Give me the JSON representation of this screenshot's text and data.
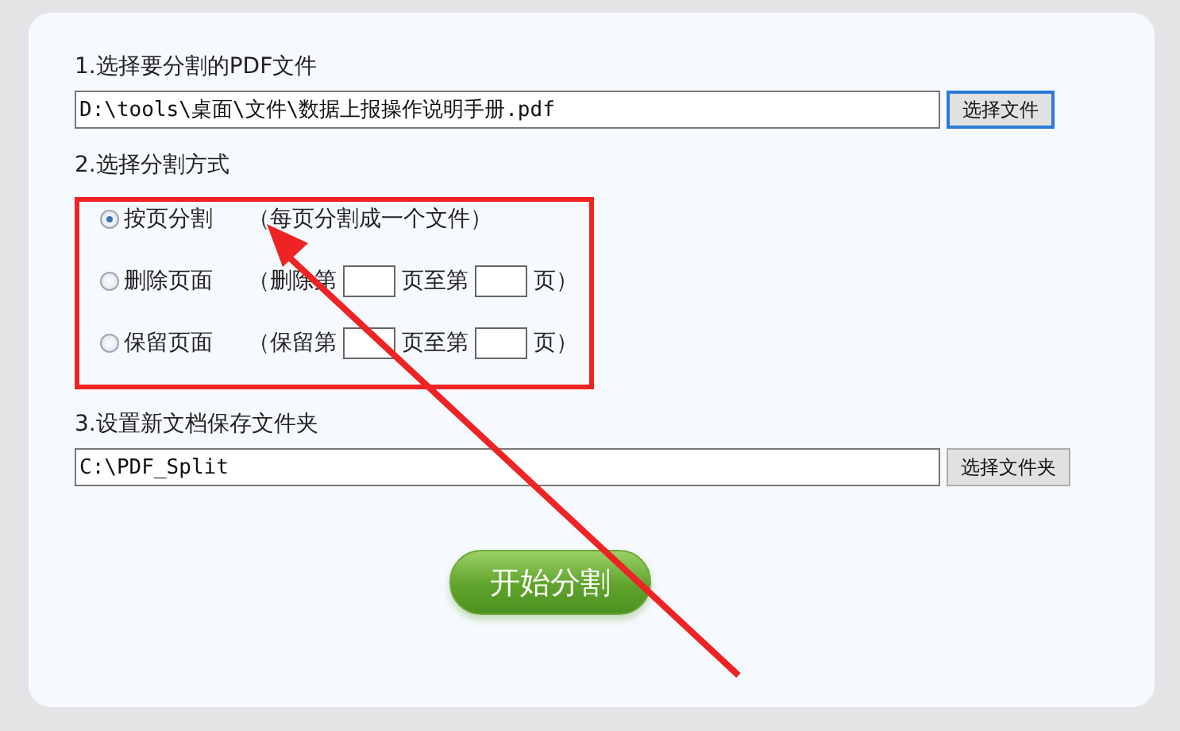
{
  "file_section": {
    "label": "1.选择要分割的PDF文件",
    "value": "D:\\tools\\桌面\\文件\\数据上报操作说明手册.pdf",
    "button": "选择文件",
    "button_focused": true
  },
  "mode_section": {
    "label": "2.选择分割方式",
    "options": [
      {
        "kind": "whole",
        "label": "按页分割",
        "note": "（每页分割成一个文件）",
        "selected": true
      },
      {
        "kind": "range",
        "label": "删除页面",
        "prefix": "（删除第",
        "middle": "页至第",
        "suffix": "页）",
        "selected": false
      },
      {
        "kind": "range",
        "label": "保留页面",
        "prefix": "（保留第",
        "middle": "页至第",
        "suffix": "页）",
        "selected": false
      }
    ]
  },
  "folder_section": {
    "label": "3.设置新文档保存文件夹",
    "value": "C:\\PDF_Split",
    "button": "选择文件夹",
    "button_focused": false
  },
  "start_button": "开始分割"
}
